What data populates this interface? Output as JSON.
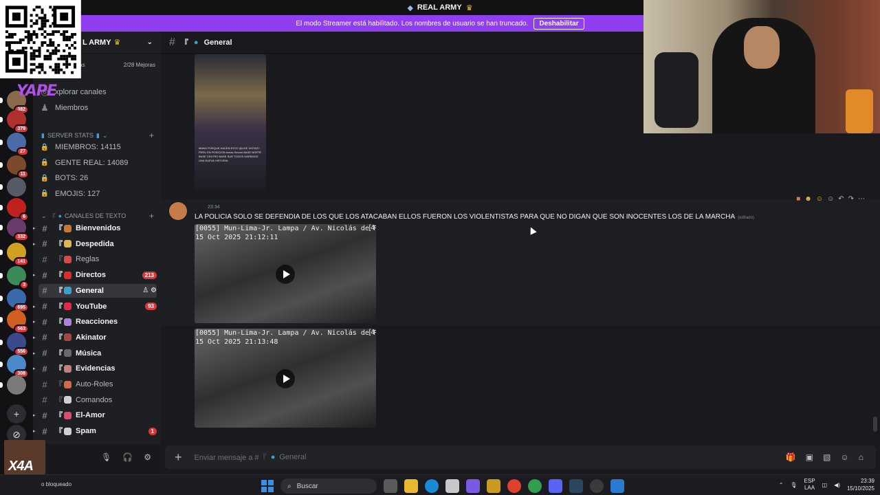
{
  "topbar": {
    "title": "REAL ARMY"
  },
  "banner": {
    "text": "El modo Streamer está habilitado. Los nombres de usuario se han truncado.",
    "button": "Deshabilitar"
  },
  "servers": [
    {
      "badge": "382",
      "color": "#8a6a4a"
    },
    {
      "badge": "379",
      "color": "#b03030"
    },
    {
      "badge": "27",
      "color": "#4a6aa8"
    },
    {
      "badge": "11",
      "color": "#7a4a2a"
    },
    {
      "badge": "",
      "color": "#555a66"
    },
    {
      "badge": "6",
      "color": "#c02020"
    },
    {
      "badge": "332",
      "color": "#6a3a6a"
    },
    {
      "badge": "141",
      "color": "#d0a020"
    },
    {
      "badge": "3",
      "color": "#3a8a5a"
    },
    {
      "badge": "695",
      "color": "#3a6aaa"
    },
    {
      "badge": "563",
      "color": "#d06020"
    },
    {
      "badge": "556",
      "color": "#3a4a8a"
    },
    {
      "badge": "308",
      "color": "#4a8ac8"
    },
    {
      "badge": "",
      "color": "#7a7a7a"
    }
  ],
  "guild": {
    "name": "L ARMY",
    "boost_left": "oras",
    "boost_right": "2/28 Mejoras"
  },
  "nav": {
    "explore": "xplorar canales",
    "members": "Miembros"
  },
  "categories": {
    "stats": "SERVER STATS",
    "channels": "CANALES DE TEXTO"
  },
  "stats": [
    "MIEMBROS: 14115",
    "GENTE REAL: 14089",
    "BOTS: 26",
    "EMOJIS: 127"
  ],
  "channels": [
    {
      "name": "Bienvenidos",
      "prefix": "『",
      "color": "#c77a2a",
      "bold": true,
      "count": ""
    },
    {
      "name": "Despedida",
      "prefix": "『",
      "color": "#e0b84a",
      "bold": true,
      "count": ""
    },
    {
      "name": "Reglas",
      "prefix": "『",
      "color": "#d44a4a",
      "bold": false,
      "count": ""
    },
    {
      "name": "Directos",
      "prefix": "『",
      "color": "#e02a2a",
      "bold": true,
      "count": "213"
    },
    {
      "name": "General",
      "prefix": "『",
      "color": "#3aa0c8",
      "bold": true,
      "count": "",
      "selected": true
    },
    {
      "name": "YouTube",
      "prefix": "『",
      "color": "#e02a4a",
      "bold": true,
      "count": "93"
    },
    {
      "name": "Reacciones",
      "prefix": "『",
      "color": "#b080e0",
      "bold": true,
      "count": ""
    },
    {
      "name": "Akinator",
      "prefix": "『",
      "color": "#aa4444",
      "bold": true,
      "count": ""
    },
    {
      "name": "Música",
      "prefix": "『",
      "color": "#6a6a6a",
      "bold": true,
      "count": ""
    },
    {
      "name": "Evidencias",
      "prefix": "『",
      "color": "#c08080",
      "bold": true,
      "count": ""
    },
    {
      "name": "Auto-Roles",
      "prefix": "『",
      "color": "#d06a4a",
      "bold": false,
      "count": ""
    },
    {
      "name": "Comandos",
      "prefix": "『",
      "color": "#d0d0d0",
      "bold": false,
      "count": ""
    },
    {
      "name": "El-Amor",
      "prefix": "『",
      "color": "#e04a6a",
      "bold": true,
      "count": ""
    },
    {
      "name": "Spam",
      "prefix": "『",
      "color": "#d0d0d0",
      "bold": true,
      "count": "1"
    }
  ],
  "channel_header": {
    "name": "General"
  },
  "first_video": {
    "caption": "MANO PORQUE HACEN ESTO @LIVE VISTAS? PERU EN POSICION tomas Secure BASE NORTE BASE CENTRO BASE SUR TODOS HAREMOS UNA NUEVA HISTORIA"
  },
  "message": {
    "time": "23:34",
    "text": "LA POLICIA SOLO SE DEFENDIA DE LOS QUE LOS ATACABAN ELLOS FUERON LOS VIOLENTISTAS PARA QUE NO DIGAN QUE SON INOCENTES LOS DE LA MARCHA",
    "edited": "(editado)"
  },
  "videos": [
    {
      "cam": "[0055] Mun-Lima-Jr. Lampa / Av. Nicolás de Piérola\n15 Oct 2025 21:12:11",
      "ch": "[4"
    },
    {
      "cam": "[0055] Mun-Lima-Jr. Lampa / Av. Nicolás de Piérola\n15 Oct 2025 21:13:48",
      "ch": "[4"
    }
  ],
  "composer": {
    "placeholder": "Enviar mensaje a #『",
    "channel": "General"
  },
  "overlay": {
    "yape": "YAPE",
    "x4": "X4A",
    "status": "o bloqueado"
  },
  "taskbar": {
    "search": "Buscar",
    "lang": "ESP",
    "lang2": "LAA",
    "time": "23:39",
    "date": "15/10/2025"
  }
}
